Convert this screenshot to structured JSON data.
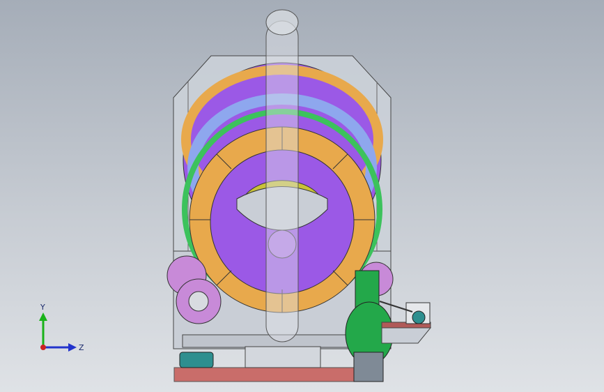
{
  "viewport": {
    "background_top": "#a5adb8",
    "background_bottom": "#dfe2e6"
  },
  "triad": {
    "y_label": "Y",
    "z_label": "Z",
    "y_color": "#19b219",
    "z_color": "#2233cc",
    "x_color": "#cc2222"
  },
  "model": {
    "colors": {
      "housing": "#c9ced6",
      "orange_ring": "#e8a94c",
      "purple_drum": "#9b59e6",
      "green_ring": "#3cc25c",
      "blue_ring": "#8ea7ee",
      "yellow_segment": "#c9c238",
      "pink_flange": "#c88ad8",
      "fan_green": "#23a84a",
      "base_red": "#c96d6a",
      "teal_motor": "#2e8f8f"
    }
  }
}
